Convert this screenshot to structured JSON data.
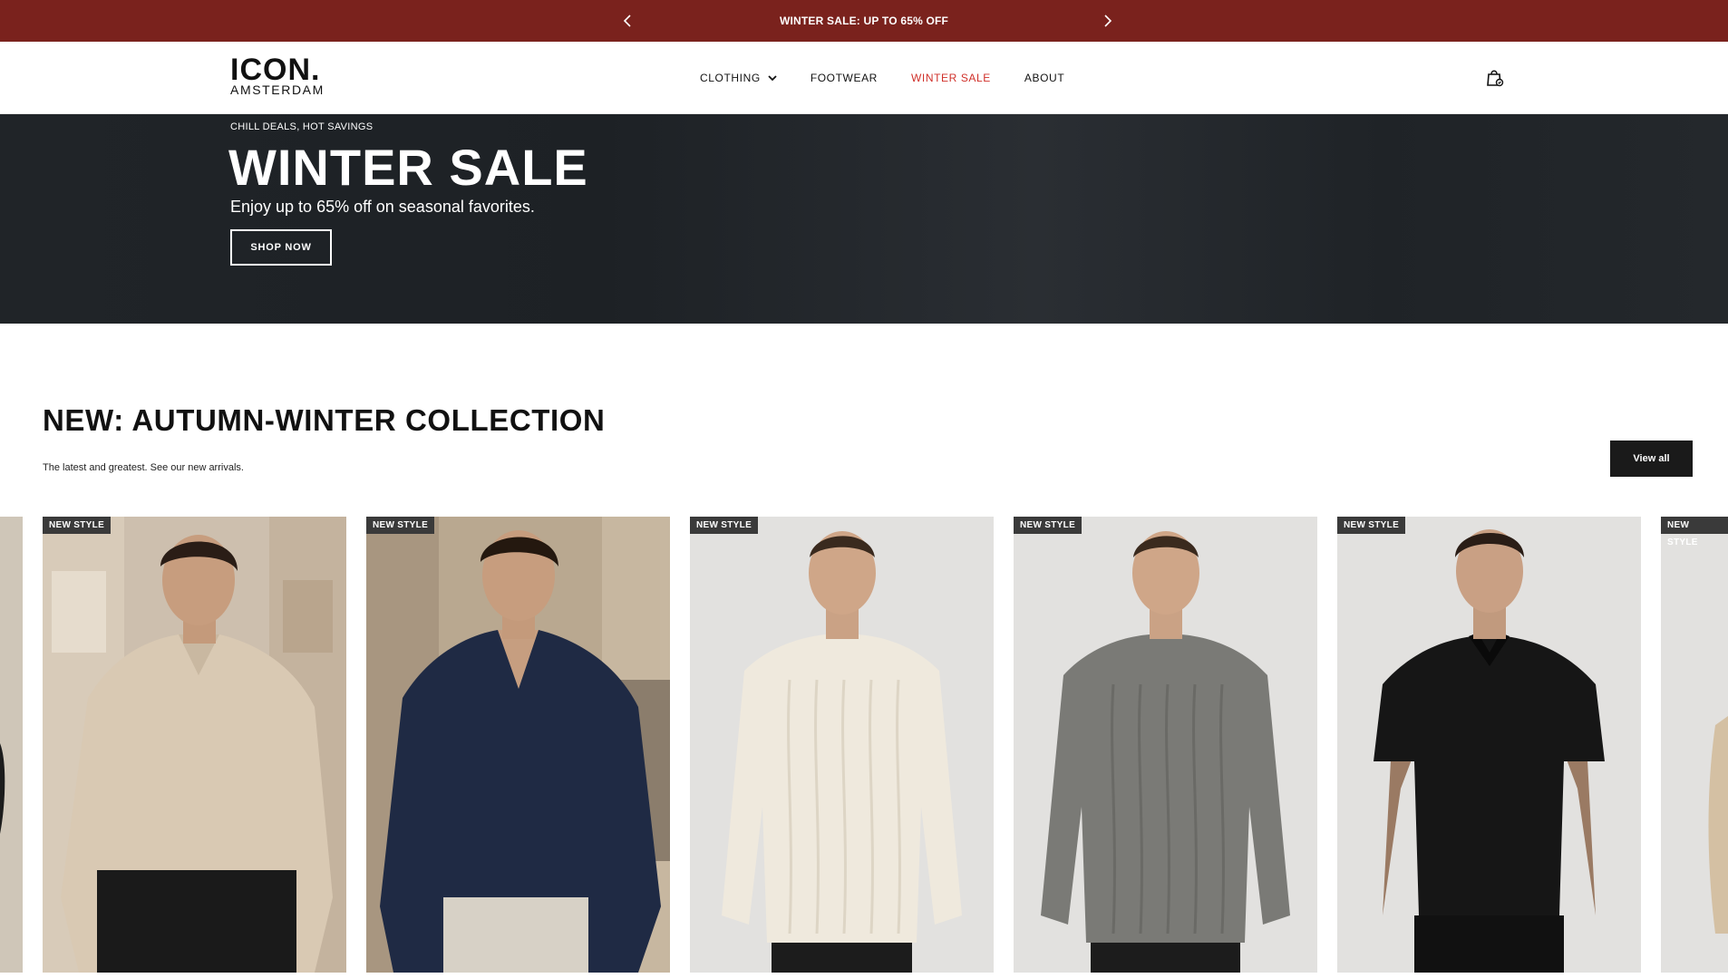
{
  "announcement": {
    "prefix": "WINTER SALE: ",
    "highlight": "UP TO 65% OFF",
    "prev_icon": "chevron-left-icon",
    "next_icon": "chevron-right-icon"
  },
  "header": {
    "logo_main": "ICON.",
    "logo_sub": "AMSTERDAM",
    "nav": [
      {
        "label": "CLOTHING",
        "has_dropdown": true
      },
      {
        "label": "FOOTWEAR"
      },
      {
        "label": "WINTER SALE",
        "highlight": true
      },
      {
        "label": "ABOUT"
      }
    ],
    "cart_icon": "shopping-bag-icon"
  },
  "hero": {
    "eyebrow": "CHILL DEALS, HOT SAVINGS",
    "title": "WINTER SALE",
    "subtitle": "Enjoy up to 65% off on seasonal favorites.",
    "cta": "SHOP NOW"
  },
  "collection": {
    "title": "NEW: AUTUMN-WINTER COLLECTION",
    "description": "The latest and greatest. See our new arrivals.",
    "view_all": "View all",
    "products": [
      {
        "badge": "NEW STYLE",
        "item": "beige shirt"
      },
      {
        "badge": "NEW STYLE",
        "item": "navy shirt"
      },
      {
        "badge": "NEW STYLE",
        "item": "cream cable knit sweater"
      },
      {
        "badge": "NEW STYLE",
        "item": "grey cable knit sweater"
      },
      {
        "badge": "NEW STYLE",
        "item": "black polo"
      },
      {
        "badge": "NEW STYLE",
        "item": "partial card"
      }
    ]
  },
  "colors": {
    "announcement_bg": "#7a221d",
    "sale_link": "#d0302a",
    "hero_bg": "#1f2327",
    "button_dark": "#1a1a1a"
  }
}
